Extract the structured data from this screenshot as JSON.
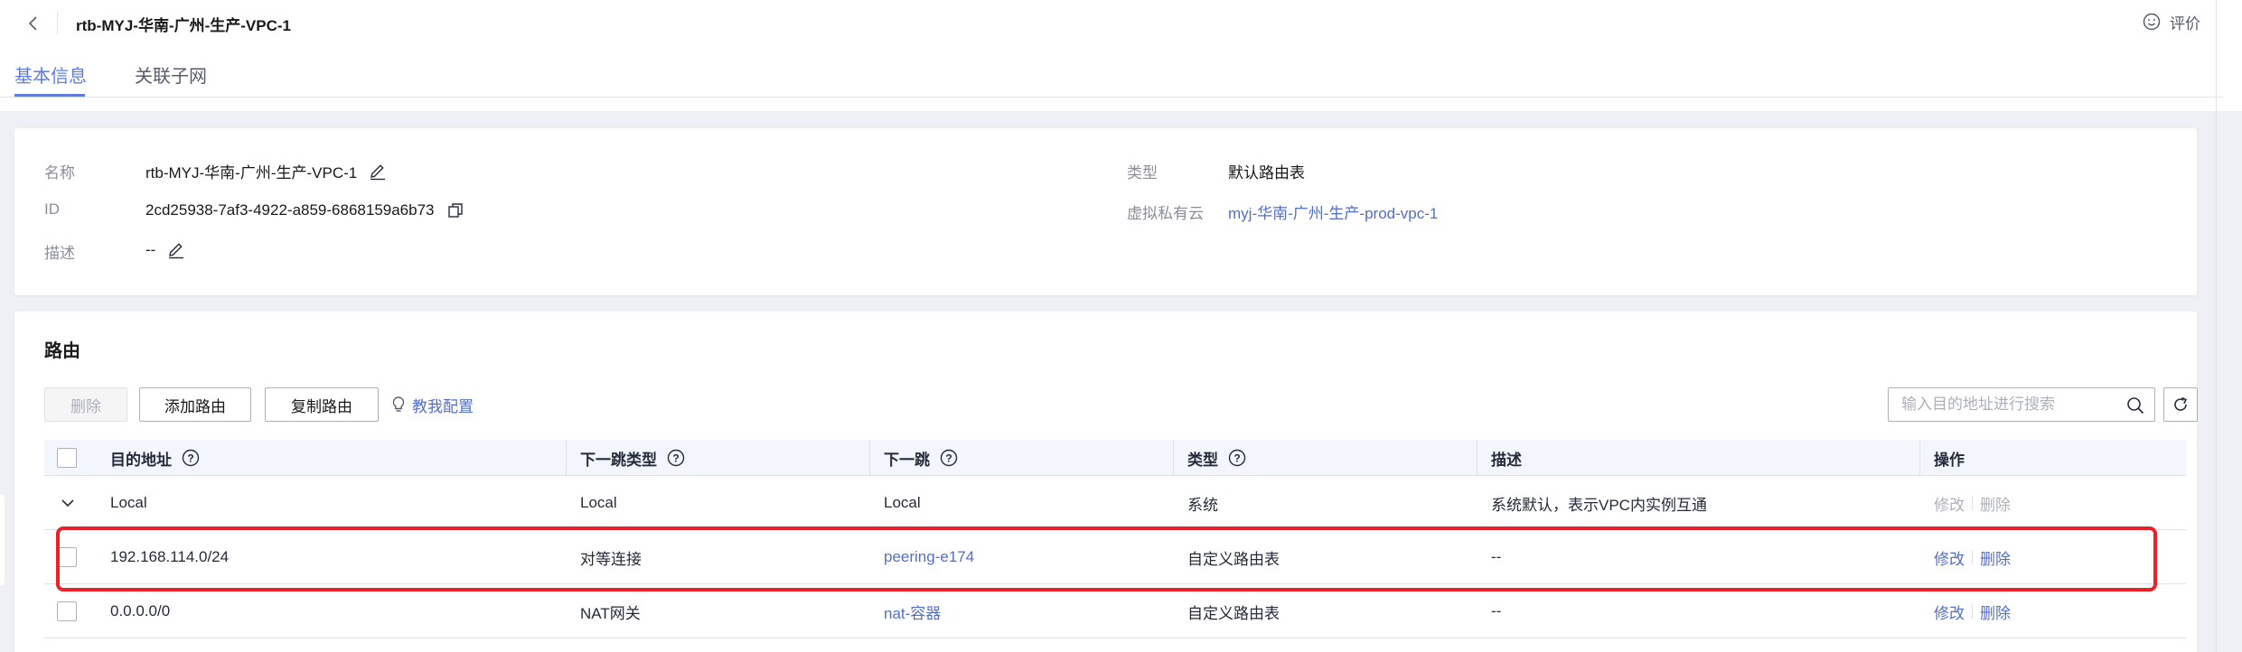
{
  "header": {
    "title": "rtb-MYJ-华南-广州-生产-VPC-1",
    "rate_label": "评价"
  },
  "tabs": [
    {
      "label": "基本信息",
      "active": true
    },
    {
      "label": "关联子网",
      "active": false
    }
  ],
  "basic_info": {
    "name_label": "名称",
    "name_value": "rtb-MYJ-华南-广州-生产-VPC-1",
    "id_label": "ID",
    "id_value": "2cd25938-7af3-4922-a859-6868159a6b73",
    "desc_label": "描述",
    "desc_value": "--",
    "type_label": "类型",
    "type_value": "默认路由表",
    "vpc_label": "虚拟私有云",
    "vpc_value": "myj-华南-广州-生产-prod-vpc-1"
  },
  "routes": {
    "section_title": "路由",
    "buttons": {
      "delete": "删除",
      "add": "添加路由",
      "copy": "复制路由",
      "teach": "教我配置"
    },
    "search_placeholder": "输入目的地址进行搜索",
    "columns": {
      "destination": "目的地址",
      "next_hop_type": "下一跳类型",
      "next_hop": "下一跳",
      "type": "类型",
      "description": "描述",
      "operations": "操作"
    },
    "rows": [
      {
        "destination": "Local",
        "next_hop_type": "Local",
        "next_hop": "Local",
        "type": "系统",
        "description": "系统默认，表示VPC内实例互通",
        "modify": "修改",
        "delete": "删除",
        "ops_enabled": false,
        "expandable": true,
        "next_hop_link": false
      },
      {
        "destination": "192.168.114.0/24",
        "next_hop_type": "对等连接",
        "next_hop": "peering-e174",
        "type": "自定义路由表",
        "description": "--",
        "modify": "修改",
        "delete": "删除",
        "ops_enabled": true,
        "expandable": false,
        "next_hop_link": true,
        "highlighted": true
      },
      {
        "destination": "0.0.0.0/0",
        "next_hop_type": "NAT网关",
        "next_hop": "nat-容器",
        "type": "自定义路由表",
        "description": "--",
        "modify": "修改",
        "delete": "删除",
        "ops_enabled": true,
        "expandable": false,
        "next_hop_link": true
      }
    ]
  },
  "colors": {
    "accent": "#5e7ce0",
    "link": "#526ecc",
    "highlight_border": "#e8212a"
  }
}
